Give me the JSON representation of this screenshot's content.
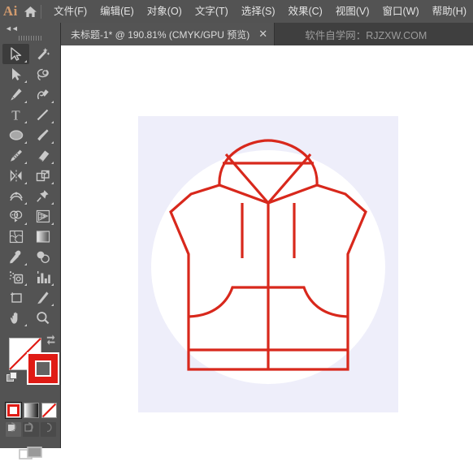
{
  "app": {
    "logo_text": "Ai",
    "home_icon": "home-icon"
  },
  "menubar": {
    "items": [
      {
        "label": "文件(F)",
        "name": "menu-file"
      },
      {
        "label": "编辑(E)",
        "name": "menu-edit"
      },
      {
        "label": "对象(O)",
        "name": "menu-object"
      },
      {
        "label": "文字(T)",
        "name": "menu-type"
      },
      {
        "label": "选择(S)",
        "name": "menu-select"
      },
      {
        "label": "效果(C)",
        "name": "menu-effect"
      },
      {
        "label": "视图(V)",
        "name": "menu-view"
      },
      {
        "label": "窗口(W)",
        "name": "menu-window"
      },
      {
        "label": "帮助(H)",
        "name": "menu-help"
      }
    ]
  },
  "tabbar": {
    "document_tab": {
      "title": "未标题-1* @ 190.81% (CMYK/GPU 预览)",
      "close_label": "✕"
    },
    "watermark": "软件自学网：RJZXW.COM"
  },
  "toolpanel": {
    "collapse_label": "◄◄",
    "tools": [
      {
        "name": "selection-tool",
        "icon": "arrow-cursor-icon",
        "active": true,
        "corner": true
      },
      {
        "name": "magic-wand-tool",
        "icon": "magic-wand-icon",
        "active": false,
        "corner": false
      },
      {
        "name": "direct-selection-tool",
        "icon": "direct-arrow-icon",
        "active": false,
        "corner": true
      },
      {
        "name": "lasso-tool",
        "icon": "lasso-icon",
        "active": false,
        "corner": false
      },
      {
        "name": "pen-tool",
        "icon": "pen-icon",
        "active": false,
        "corner": true
      },
      {
        "name": "curvature-tool",
        "icon": "curvature-pen-icon",
        "active": false,
        "corner": true
      },
      {
        "name": "type-tool",
        "icon": "type-t-icon",
        "active": false,
        "corner": true
      },
      {
        "name": "line-segment-tool",
        "icon": "line-segment-icon",
        "active": false,
        "corner": true
      },
      {
        "name": "ellipse-tool",
        "icon": "ellipse-icon",
        "active": false,
        "corner": true
      },
      {
        "name": "paintbrush-tool",
        "icon": "paintbrush-icon",
        "active": false,
        "corner": true
      },
      {
        "name": "shaper-pencil-tool",
        "icon": "pencil-shaper-icon",
        "active": false,
        "corner": true
      },
      {
        "name": "eraser-tool",
        "icon": "eraser-icon",
        "active": false,
        "corner": true
      },
      {
        "name": "rotate-reflect-tool",
        "icon": "reflect-icon",
        "active": false,
        "corner": true
      },
      {
        "name": "scale-shear-tool",
        "icon": "scale-transform-icon",
        "active": false,
        "corner": true
      },
      {
        "name": "width-warp-tool",
        "icon": "width-warp-icon",
        "active": false,
        "corner": true
      },
      {
        "name": "free-transform-tool",
        "icon": "pushpin-icon",
        "active": false,
        "corner": true
      },
      {
        "name": "shape-builder-tool",
        "icon": "shape-builder-icon",
        "active": false,
        "corner": true
      },
      {
        "name": "perspective-grid-tool",
        "icon": "perspective-grid-icon",
        "active": false,
        "corner": true
      },
      {
        "name": "mesh-tool",
        "icon": "mesh-icon",
        "active": false,
        "corner": false
      },
      {
        "name": "gradient-tool",
        "icon": "gradient-icon",
        "active": false,
        "corner": false
      },
      {
        "name": "eyedropper-tool",
        "icon": "eyedropper-icon",
        "active": false,
        "corner": true
      },
      {
        "name": "blend-tool",
        "icon": "blend-icon",
        "active": false,
        "corner": false
      },
      {
        "name": "symbol-sprayer-tool",
        "icon": "symbol-sprayer-icon",
        "active": false,
        "corner": true
      },
      {
        "name": "column-graph-tool",
        "icon": "bar-graph-icon",
        "active": false,
        "corner": true
      },
      {
        "name": "artboard-tool",
        "icon": "artboard-icon",
        "active": false,
        "corner": false
      },
      {
        "name": "slice-tool",
        "icon": "slice-knife-icon",
        "active": false,
        "corner": true
      },
      {
        "name": "hand-tool",
        "icon": "hand-icon",
        "active": false,
        "corner": true
      },
      {
        "name": "zoom-tool",
        "icon": "magnifier-icon",
        "active": false,
        "corner": false
      }
    ],
    "color": {
      "fill_color": "#ffffff",
      "fill_is_none": true,
      "stroke_color": "#e01b15",
      "swap_icon": "swap-arrows-icon",
      "default_icon": "default-colors-icon"
    },
    "paint_modes": [
      {
        "name": "color-mode-button",
        "icon": "solid-color-icon",
        "selected": true
      },
      {
        "name": "gradient-mode-button",
        "icon": "gradient-swatch-icon",
        "selected": false
      },
      {
        "name": "none-mode-button",
        "icon": "none-swatch-icon",
        "selected": false
      }
    ],
    "draw_modes": [
      {
        "name": "draw-normal-button",
        "icon": "draw-normal-icon",
        "selected": true
      },
      {
        "name": "draw-behind-button",
        "icon": "draw-behind-icon",
        "selected": false
      },
      {
        "name": "draw-inside-button",
        "icon": "draw-inside-icon",
        "selected": false
      }
    ],
    "screen_mode": {
      "name": "change-screen-mode-button",
      "icon": "screen-mode-icon"
    }
  },
  "canvas": {
    "artboard_background": "#eeeefa",
    "artwork": {
      "name": "hooded-vest-illustration",
      "circle_color": "#ffffff",
      "stroke_color": "#d8281c",
      "stroke_width": 3
    }
  }
}
